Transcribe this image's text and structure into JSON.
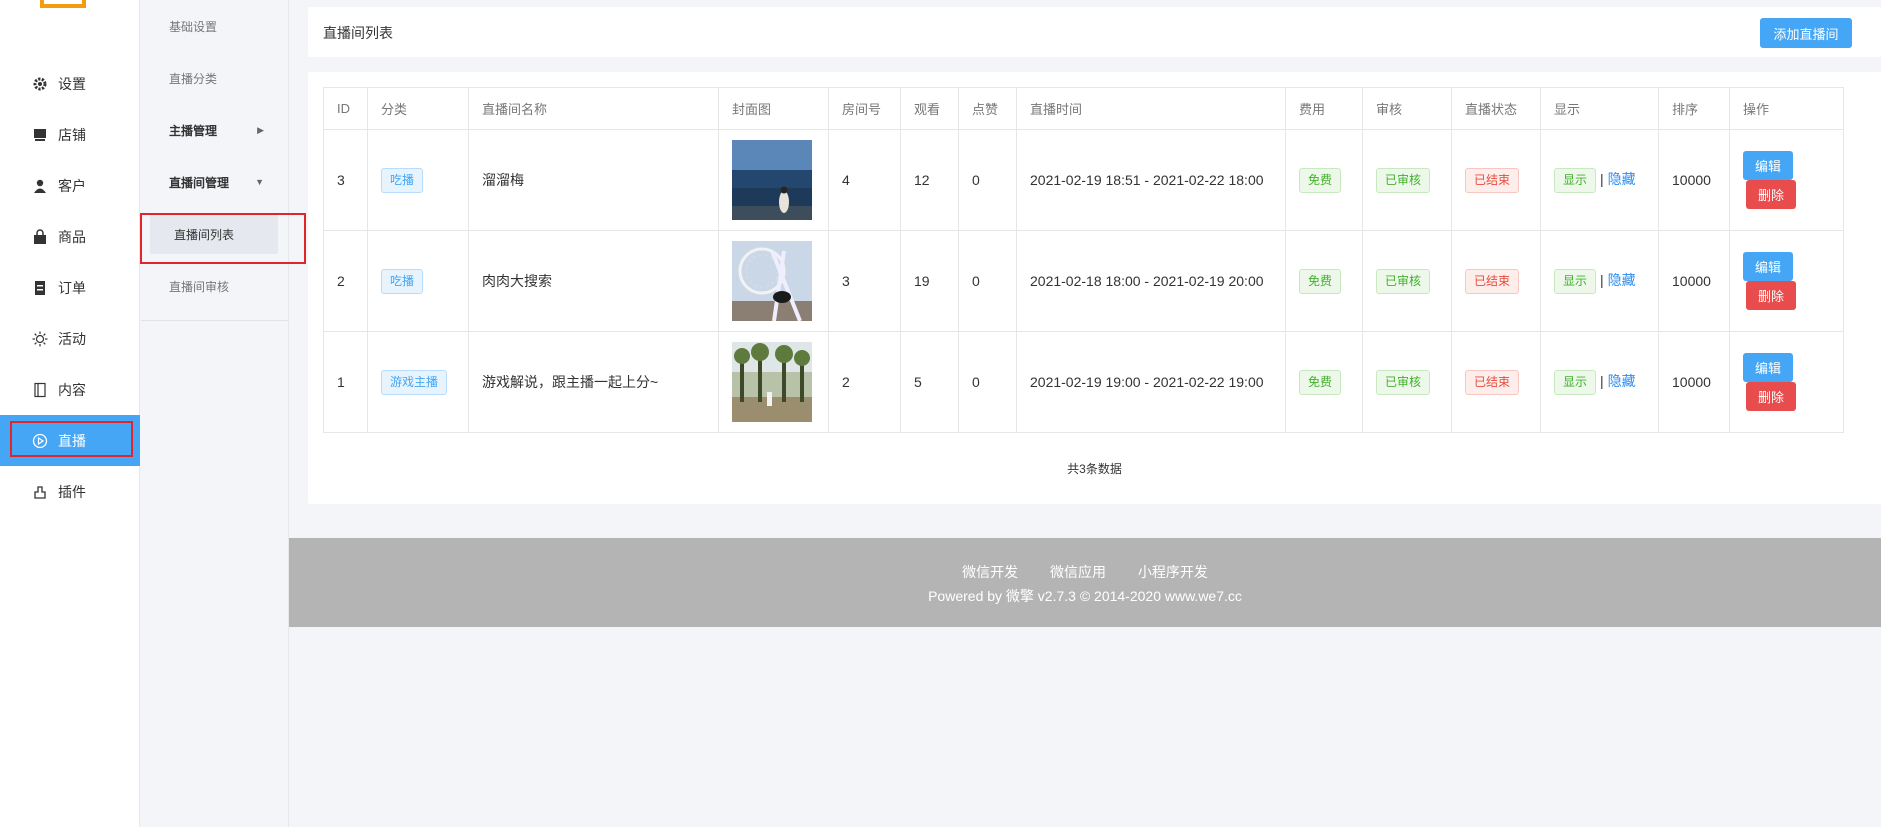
{
  "sidebar": {
    "items": [
      {
        "label": "设置",
        "icon": "gear-icon"
      },
      {
        "label": "店铺",
        "icon": "store-icon"
      },
      {
        "label": "客户",
        "icon": "user-icon"
      },
      {
        "label": "商品",
        "icon": "bag-icon"
      },
      {
        "label": "订单",
        "icon": "order-icon"
      },
      {
        "label": "活动",
        "icon": "sun-icon"
      },
      {
        "label": "内容",
        "icon": "book-icon"
      },
      {
        "label": "直播",
        "icon": "play-circle-icon"
      },
      {
        "label": "插件",
        "icon": "plugin-icon"
      }
    ],
    "active_index": 7
  },
  "subnav": {
    "items": [
      "基础设置",
      "直播分类",
      "主播管理",
      "直播间管理",
      "直播间列表",
      "直播间审核"
    ]
  },
  "header": {
    "title": "直播间列表",
    "add_label": "添加直播间"
  },
  "table": {
    "columns": [
      "ID",
      "分类",
      "直播间名称",
      "封面图",
      "房间号",
      "观看",
      "点赞",
      "直播时间",
      "费用",
      "审核",
      "直播状态",
      "显示",
      "操作"
    ],
    "rows": [
      {
        "id": "3",
        "category": "吃播",
        "name": "溜溜梅",
        "room": "4",
        "views": "12",
        "likes": "0",
        "time": "2021-02-19 18:51 - 2021-02-22 18:00",
        "fee": "免费",
        "audit": "已审核",
        "status": "已结束",
        "show": "显示",
        "hide": "隐藏",
        "sort": "10000",
        "edit": "编辑",
        "delete": "删除"
      },
      {
        "id": "2",
        "category": "吃播",
        "name": "肉肉大搜索",
        "room": "3",
        "views": "19",
        "likes": "0",
        "time": "2021-02-18 18:00 - 2021-02-19 20:00",
        "fee": "免费",
        "audit": "已审核",
        "status": "已结束",
        "show": "显示",
        "hide": "隐藏",
        "sort": "10000",
        "edit": "编辑",
        "delete": "删除"
      },
      {
        "id": "1",
        "category": "游戏主播",
        "name": "游戏解说，跟主播一起上分~",
        "room": "2",
        "views": "5",
        "likes": "0",
        "time": "2021-02-19 19:00 - 2021-02-22 19:00",
        "fee": "免费",
        "audit": "已审核",
        "status": "已结束",
        "show": "显示",
        "hide": "隐藏",
        "sort": "10000",
        "edit": "编辑",
        "delete": "删除"
      }
    ],
    "sort_header": "排序",
    "total": "共3条数据"
  },
  "footer": {
    "links": [
      "微信开发",
      "微信应用",
      "小程序开发"
    ],
    "copyright": "Powered by 微擎 v2.7.3 © 2014-2020 www.we7.cc"
  },
  "colors": {
    "primary": "#44a6f4",
    "danger": "#e84c4c",
    "success": "#42b12c",
    "highlight": "#e0262b"
  }
}
